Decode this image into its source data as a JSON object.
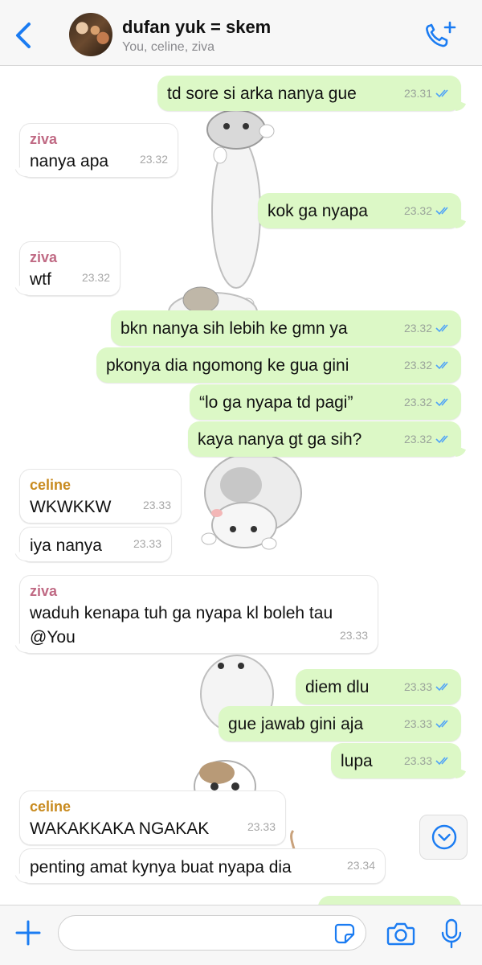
{
  "header": {
    "back_icon": "chevron-left-icon",
    "title": "dufan yuk = skem",
    "subtitle": "You, celine, ziva",
    "call_icon": "phone-plus-icon",
    "accent_color": "#1b7cf2"
  },
  "messages": [
    {
      "dir": "out",
      "text": "td sore si arka nanya gue",
      "time": "23.31"
    },
    {
      "dir": "in",
      "sender": "ziva",
      "text": "nanya apa",
      "time": "23.32"
    },
    {
      "dir": "out",
      "text": "kok ga nyapa",
      "time": "23.32"
    },
    {
      "dir": "in",
      "sender": "ziva",
      "text": "wtf",
      "time": "23.32"
    },
    {
      "dir": "out",
      "text": "bkn nanya sih lebih ke gmn ya",
      "time": "23.32"
    },
    {
      "dir": "out",
      "text": "pkonya dia ngomong ke gua gini",
      "time": "23.32"
    },
    {
      "dir": "out",
      "text": "“lo ga nyapa td pagi”",
      "time": "23.32"
    },
    {
      "dir": "out",
      "text": "kaya nanya gt ga sih?",
      "time": "23.32"
    },
    {
      "dir": "in",
      "sender": "celine",
      "text": "WKWKKW",
      "time": "23.33"
    },
    {
      "dir": "in",
      "text": "iya nanya",
      "time": "23.33"
    },
    {
      "dir": "in",
      "sender": "ziva",
      "text_line1": "waduh kenapa tuh ga nyapa kl boleh tau",
      "text_line2": "@You",
      "time": "23.33"
    },
    {
      "dir": "out",
      "text": "diem dlu",
      "time": "23.33"
    },
    {
      "dir": "out",
      "text": "gue jawab gini aja",
      "time": "23.33"
    },
    {
      "dir": "out",
      "text": "lupa",
      "time": "23.33"
    },
    {
      "dir": "in",
      "sender": "celine",
      "text": "WAKAKKAKA NGAKAK",
      "time": "23.33"
    },
    {
      "dir": "in",
      "text": "penting amat kynya buat nyapa dia",
      "time": "23.34"
    }
  ],
  "colors": {
    "outgoing_bubble": "#dcf8c6",
    "incoming_bubble": "#ffffff",
    "ziva_name": "#c06a84",
    "celine_name": "#c88a1e",
    "read_ticks": "#4fa3f7"
  },
  "scroll_button_icon": "chevron-down-circle-icon",
  "input": {
    "plus_icon": "plus-icon",
    "placeholder": "",
    "sticker_icon": "sticker-icon",
    "camera_icon": "camera-icon",
    "mic_icon": "microphone-icon"
  }
}
